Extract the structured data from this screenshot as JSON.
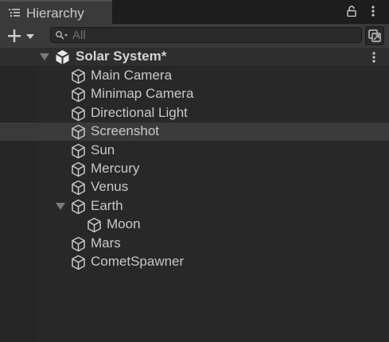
{
  "window": {
    "tab_label": "Hierarchy",
    "tab_icon": "hierarchy-list-icon",
    "lock_icon": "lock-icon",
    "menu_icon": "kebab-menu-icon"
  },
  "toolbar": {
    "add_icon": "plus-dropdown-icon",
    "search_placeholder": "All",
    "search_icon": "search-icon",
    "scene_visibility_icon": "scene-visibility-icon"
  },
  "hierarchy": {
    "scene": {
      "name": "Solar System*",
      "expanded": true,
      "icon": "unity-scene-icon"
    },
    "items": [
      {
        "label": "Main Camera",
        "depth": 1
      },
      {
        "label": "Minimap Camera",
        "depth": 1
      },
      {
        "label": "Directional Light",
        "depth": 1
      },
      {
        "label": "Screenshot",
        "depth": 1,
        "selected": true
      },
      {
        "label": "Sun",
        "depth": 1
      },
      {
        "label": "Mercury",
        "depth": 1
      },
      {
        "label": "Venus",
        "depth": 1
      },
      {
        "label": "Earth",
        "depth": 1,
        "expanded": true
      },
      {
        "label": "Moon",
        "depth": 2
      },
      {
        "label": "Mars",
        "depth": 1
      },
      {
        "label": "CometSpawner",
        "depth": 1
      }
    ]
  },
  "colors": {
    "background": "#282828",
    "toolbar": "#3a3a3a",
    "selected_row": "#3a3a3a",
    "text": "#c8c8c8"
  }
}
